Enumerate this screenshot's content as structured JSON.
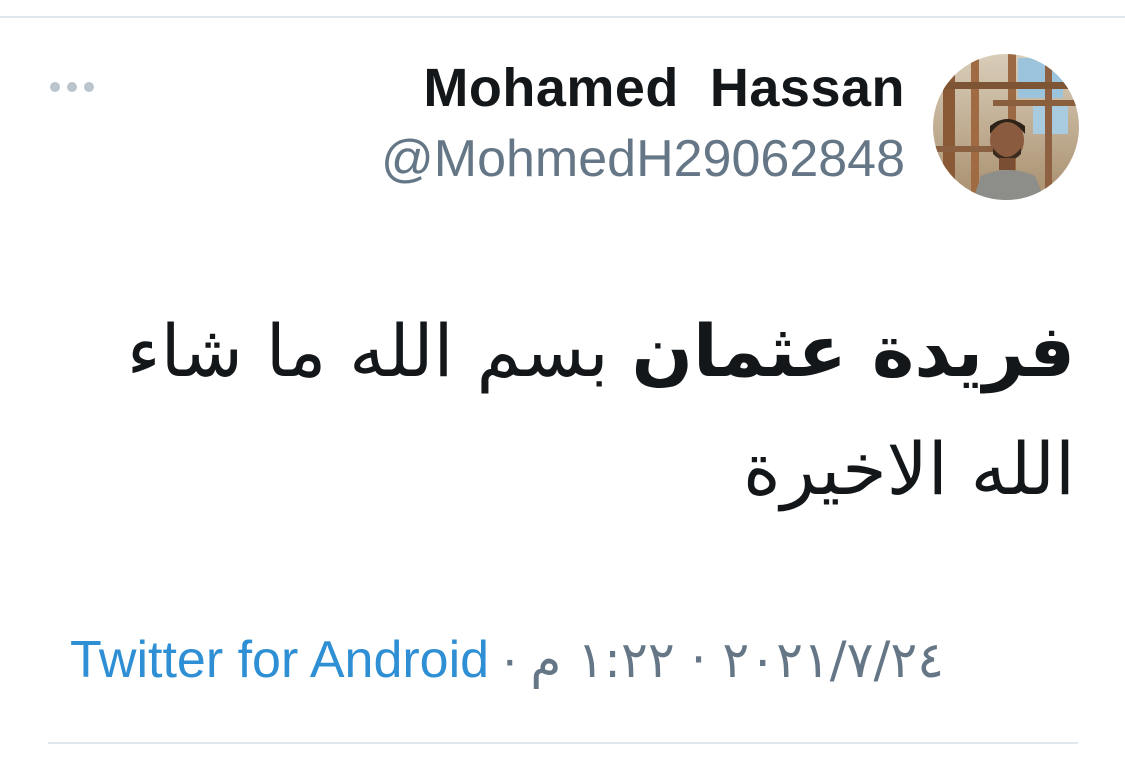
{
  "tweet": {
    "author": {
      "display_name": "Mohamed  Hassan",
      "handle": "@MohmedH29062848",
      "avatar_icon": "user-photo"
    },
    "more_icon": "more-horizontal-icon",
    "text_bold": "فريدة عثمان",
    "text_rest": "بسم الله ما شاء الله الاخيرة",
    "timestamp": "٢٠٢١/٧/٢٤ · ١:٢٢ م",
    "separator": "·",
    "source": "Twitter for Android"
  },
  "colors": {
    "link": "#2e8fd4",
    "muted": "#657786",
    "text": "#14171a",
    "divider": "#e1e8ed"
  }
}
